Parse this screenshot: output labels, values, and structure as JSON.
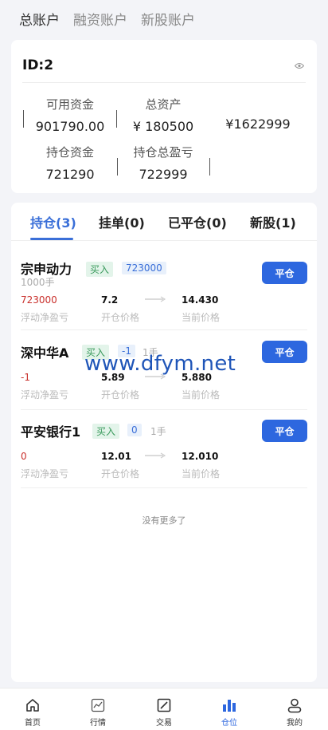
{
  "top_tabs": [
    {
      "label": "总账户"
    },
    {
      "label": "融资账户"
    },
    {
      "label": "新股账户"
    }
  ],
  "account": {
    "id_label": "ID:2",
    "available_label": "可用资金",
    "available_value": "901790.00",
    "total_assets_label": "总资产",
    "total_assets_value": "¥ 180500",
    "extra_value": "¥1622999",
    "position_funds_label": "持仓资金",
    "position_funds_value": "721290",
    "position_pnl_label": "持仓总盈亏",
    "position_pnl_value": "722999"
  },
  "position_tabs": [
    {
      "label": "持仓(3)"
    },
    {
      "label": "挂单(0)"
    },
    {
      "label": "已平仓(0)"
    },
    {
      "label": "新股(1)"
    }
  ],
  "field_labels": {
    "float_pnl": "浮动净盈亏",
    "open_price": "开仓价格",
    "current_price": "当前价格"
  },
  "positions": [
    {
      "name": "宗申动力",
      "side": "买入",
      "qty": "723000",
      "lots": "1000手",
      "close": "平仓",
      "pnl": "723000",
      "open_price": "7.2",
      "current_price": "14.430"
    },
    {
      "name": "深中华A",
      "side": "买入",
      "qty": "-1",
      "lots": "1手",
      "close": "平仓",
      "pnl": "-1",
      "open_price": "5.89",
      "current_price": "5.880"
    },
    {
      "name": "平安银行1",
      "side": "买入",
      "qty": "0",
      "lots": "1手",
      "close": "平仓",
      "pnl": "0",
      "open_price": "12.01",
      "current_price": "12.010"
    }
  ],
  "no_more": "没有更多了",
  "watermark": "www.dfym.net",
  "bottom_nav": [
    {
      "label": "首页",
      "icon": "home-icon"
    },
    {
      "label": "行情",
      "icon": "chart-icon"
    },
    {
      "label": "交易",
      "icon": "trade-icon"
    },
    {
      "label": "仓位",
      "icon": "position-icon"
    },
    {
      "label": "我的",
      "icon": "user-icon"
    }
  ],
  "colors": {
    "accent": "#2d67df",
    "tab_active": "#3a6fd8",
    "loss_red": "#c9302c",
    "buy_green": "#3a9a5c"
  }
}
